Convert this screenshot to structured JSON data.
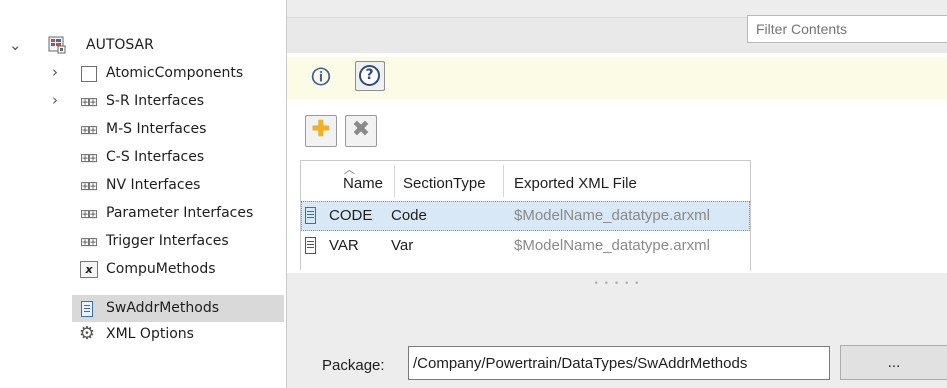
{
  "tree": {
    "root": {
      "label": "AUTOSAR",
      "expanded": true,
      "icon": "autosar-package-icon"
    },
    "items": [
      {
        "label": "AtomicComponents",
        "icon": "component-icon",
        "expandable": true
      },
      {
        "label": "S-R Interfaces",
        "icon": "interface-icon",
        "expandable": true
      },
      {
        "label": "M-S Interfaces",
        "icon": "interface-icon",
        "expandable": false
      },
      {
        "label": "C-S Interfaces",
        "icon": "interface-icon",
        "expandable": false
      },
      {
        "label": "NV Interfaces",
        "icon": "interface-icon",
        "expandable": false
      },
      {
        "label": "Parameter Interfaces",
        "icon": "interface-icon",
        "expandable": false
      },
      {
        "label": "Trigger Interfaces",
        "icon": "interface-icon",
        "expandable": false
      },
      {
        "label": "CompuMethods",
        "icon": "function-icon",
        "expandable": false
      },
      {
        "label": "SwAddrMethods",
        "icon": "document-icon",
        "expandable": false,
        "selected": true
      },
      {
        "label": "XML Options",
        "icon": "gear-icon",
        "expandable": false
      }
    ]
  },
  "filter": {
    "placeholder": "Filter Contents"
  },
  "toolbar": {
    "info_icon": "info-icon",
    "help_icon": "help-icon",
    "add_icon": "add-icon",
    "delete_icon": "delete-icon",
    "help_glyph": "?"
  },
  "table": {
    "columns": [
      "Name",
      "SectionType",
      "Exported XML File"
    ],
    "rows": [
      {
        "name": "CODE",
        "section_type": "Code",
        "xml_file": "$ModelName_datatype.arxml",
        "selected": true
      },
      {
        "name": "VAR",
        "section_type": "Var",
        "xml_file": "$ModelName_datatype.arxml",
        "selected": false
      }
    ]
  },
  "package": {
    "label": "Package:",
    "value": "/Company/Powertrain/DataTypes/SwAddrMethods",
    "browse_label": "..."
  },
  "colors": {
    "info_bar": "#fcfce6",
    "selection": "#d9e8f6",
    "tree_selection": "#d9d9d9",
    "panel": "#ededed"
  }
}
